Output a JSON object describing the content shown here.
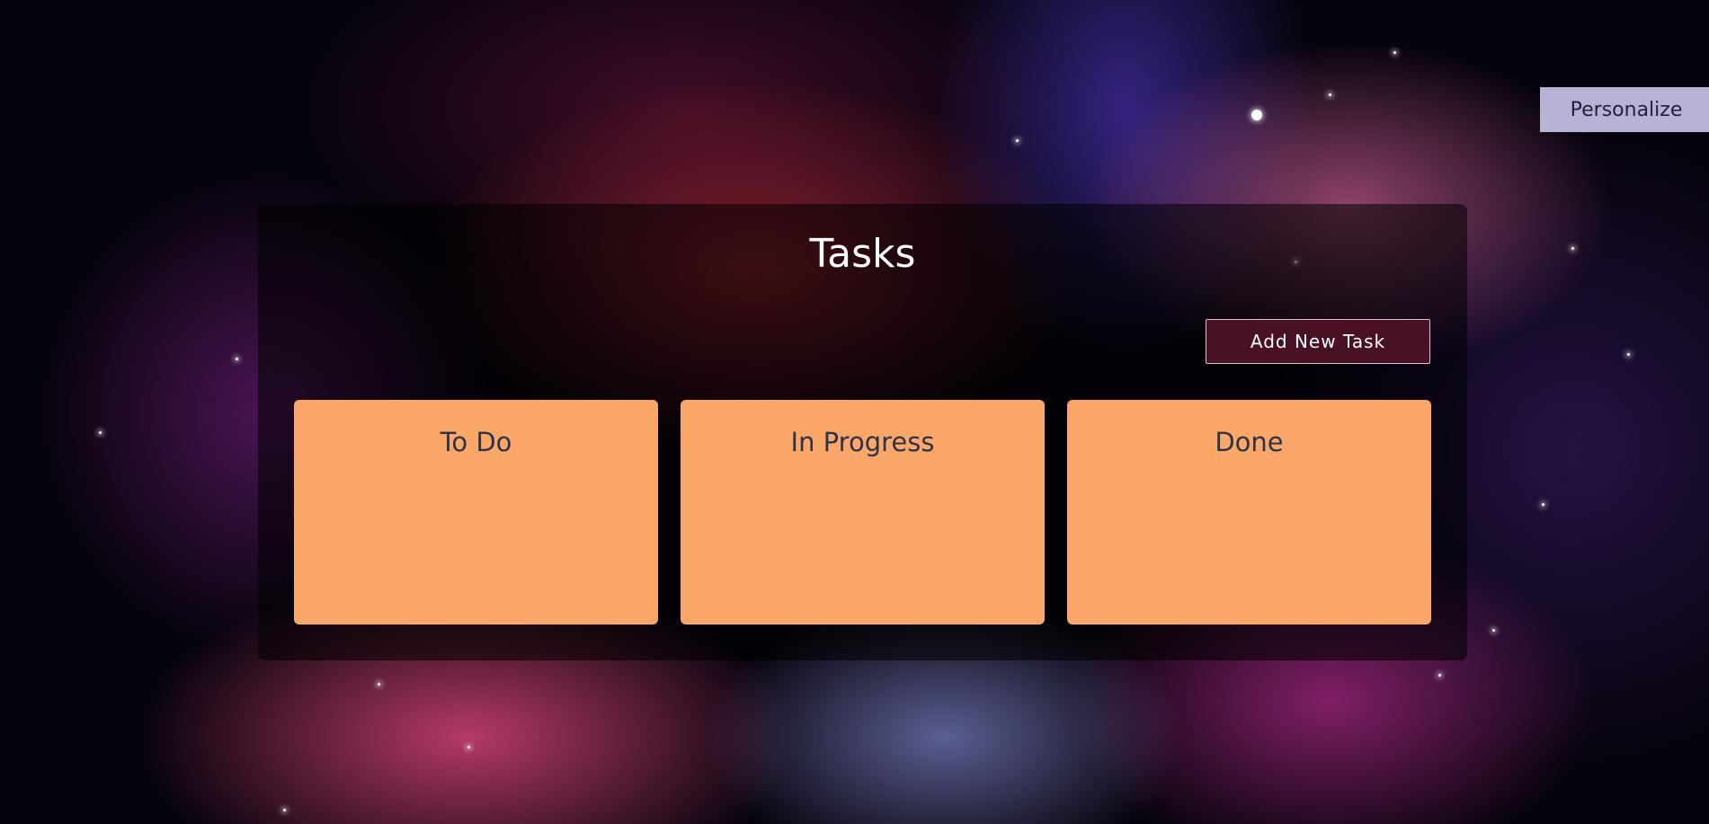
{
  "header": {
    "personalize_label": "Personalize"
  },
  "board": {
    "title": "Tasks",
    "add_button_label": "Add New Task",
    "columns": [
      {
        "label": "To Do"
      },
      {
        "label": "In Progress"
      },
      {
        "label": "Done"
      }
    ]
  },
  "colors": {
    "column_bg": "#fba76a",
    "add_button_bg": "#4a1125",
    "personalize_bg": "#b7b3d6",
    "board_overlay": "rgba(0,0,0,0.55)"
  }
}
